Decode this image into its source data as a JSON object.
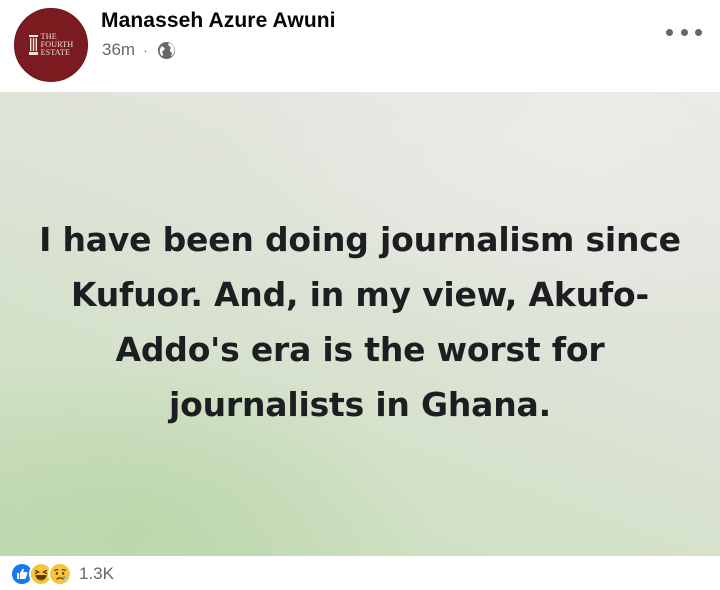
{
  "post": {
    "avatar_lines": [
      "THE",
      "FOURTH",
      "ESTATE"
    ],
    "author": "Manasseh Azure Awuni",
    "timestamp": "36m",
    "separator": "·",
    "privacy_icon": "globe-icon",
    "more_icon": "more-options-icon",
    "text": "I have been doing journalism since Kufuor. And, in my view, Akufo-Addo's era is the worst for journalists in Ghana."
  },
  "reactions": {
    "icons": [
      "like-reaction-icon",
      "haha-reaction-icon",
      "sad-reaction-icon"
    ],
    "count": "1.3K"
  },
  "colors": {
    "avatar_bg": "#7a1b1f",
    "like_blue": "#1877f2",
    "emoji_yellow": "#f7c53c",
    "meta_gray": "#65676b"
  }
}
